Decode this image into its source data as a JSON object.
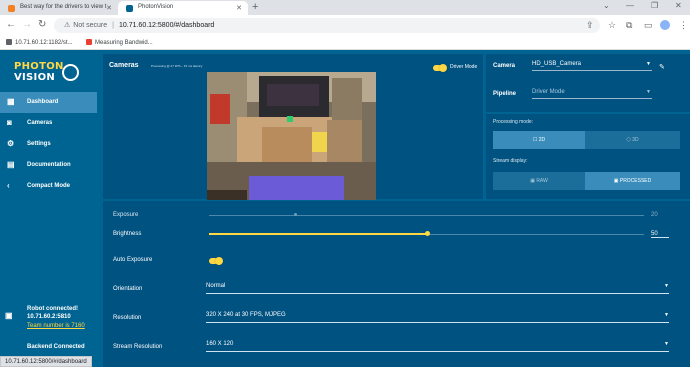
{
  "browser": {
    "tabs": [
      {
        "title": "Best way for the drivers to view t",
        "active": false
      },
      {
        "title": "PhotonVision",
        "active": true
      }
    ],
    "address": {
      "security": "Not secure",
      "url": "10.71.60.12:5800/#/dashboard"
    },
    "bookmarks": [
      "10.71.60.12:1182/st...",
      "Measuring Bandwid..."
    ],
    "status_url": "10.71.60.12:5800/#/dashboard"
  },
  "sidebar": {
    "logo_line1": "PHOTON",
    "logo_line2": "VISION",
    "items": [
      {
        "label": "Dashboard",
        "icon": "dashboard-icon",
        "active": true
      },
      {
        "label": "Cameras",
        "icon": "camera-icon",
        "active": false
      },
      {
        "label": "Settings",
        "icon": "gear-icon",
        "active": false
      },
      {
        "label": "Documentation",
        "icon": "book-icon",
        "active": false
      },
      {
        "label": "Compact Mode",
        "icon": "chevron-left-icon",
        "active": false
      }
    ],
    "status": {
      "robot": "Robot connected!",
      "address": "10.71.60.2:5810",
      "team": "Team number is 7160",
      "backend": "Backend Connected"
    }
  },
  "cameras_card": {
    "title": "Cameras",
    "subtitle": "Processing @ 27 FPS – 15 ms latency",
    "driver_mode_label": "Driver Mode",
    "driver_mode_on": true
  },
  "camera_select": {
    "camera_label": "Camera",
    "camera_value": "HD_USB_Camera",
    "pipeline_label": "Pipeline",
    "pipeline_value": "Driver Mode"
  },
  "processing": {
    "mode_label": "Processing mode:",
    "mode_options": [
      "2D",
      "3D"
    ],
    "mode_selected": "2D",
    "stream_label": "Stream display:",
    "stream_options": [
      "RAW",
      "PROCESSED"
    ],
    "stream_selected": "PROCESSED"
  },
  "settings": {
    "exposure": {
      "label": "Exposure",
      "value": "20",
      "level": 0.2
    },
    "brightness": {
      "label": "Brightness",
      "value": "50",
      "level": 0.5
    },
    "auto_exposure": {
      "label": "Auto Exposure",
      "on": true
    },
    "orientation": {
      "label": "Orientation",
      "value": "Normal"
    },
    "resolution": {
      "label": "Resolution",
      "value": "320 X 240 at 30 FPS, MJPEG"
    },
    "stream_resolution": {
      "label": "Stream Resolution",
      "value": "160 X 120"
    }
  },
  "colors": {
    "primary": "#006492",
    "card": "#005281",
    "accent": "#ffd843",
    "highlight": "#3a8dbb"
  }
}
